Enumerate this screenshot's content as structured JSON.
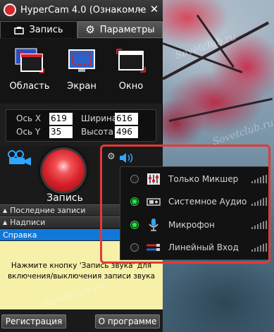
{
  "window": {
    "title": "HyperCam 4.0 (Ознакомле",
    "minimize": "–",
    "close": "✕"
  },
  "tabs": [
    {
      "label": "Запись",
      "icon": "record-icon",
      "active": true
    },
    {
      "label": "Параметры",
      "icon": "gear-icon",
      "active": false
    }
  ],
  "modes": [
    {
      "label": "Область",
      "icon": "region-icon"
    },
    {
      "label": "Экран",
      "icon": "screen-icon"
    },
    {
      "label": "Окно",
      "icon": "window-icon"
    }
  ],
  "coords": {
    "x_label": "Ось X",
    "x_value": "619",
    "y_label": "Ось Y",
    "y_value": "35",
    "w_label": "Ширина",
    "w_value": "616",
    "h_label": "Высота",
    "h_value": "496"
  },
  "record": {
    "label": "Запись"
  },
  "sections": {
    "recent": "Последние записи",
    "notes": "Надписи",
    "help": "Справка"
  },
  "help_text": "Нажмите кнопку 'Запись звука' для включения/выключения записи звука",
  "buttons": {
    "register": "Регистрация",
    "about": "О программе"
  },
  "audio_options": [
    {
      "label": "Только Микшер",
      "icon": "mixer-icon",
      "selected": false
    },
    {
      "label": "Системное Аудио",
      "icon": "speaker-icon",
      "selected": true
    },
    {
      "label": "Микрофон",
      "icon": "microphone-icon",
      "selected": true
    },
    {
      "label": "Линейный Вход",
      "icon": "line-in-icon",
      "selected": false
    }
  ],
  "colors": {
    "accent_red": "#d6202a",
    "selection_blue": "#1078d8",
    "help_bg": "#f7f0a9",
    "highlight": "#e53935",
    "radio_on": "#2fd447"
  },
  "watermark": "Sovetclub.ru"
}
